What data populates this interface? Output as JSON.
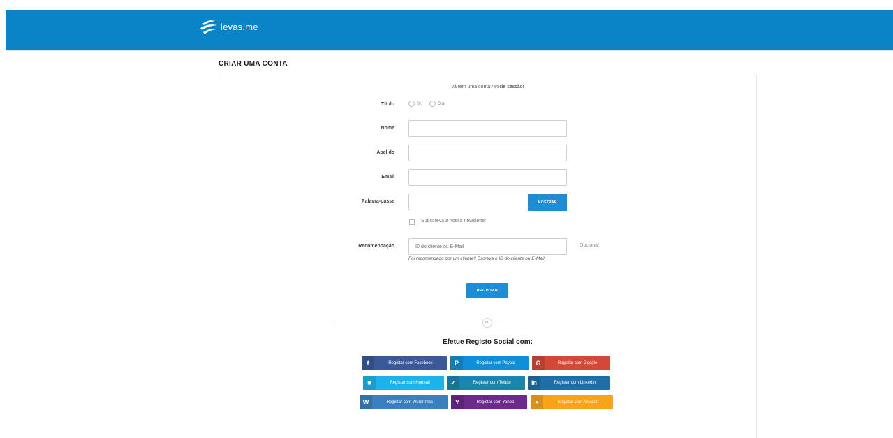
{
  "header": {
    "logo_text": "levas.me"
  },
  "page": {
    "title": "CRIAR UMA CONTA"
  },
  "login_prompt": {
    "text": "Já tem uma conta?",
    "link": "Inicie sessão!"
  },
  "form": {
    "title_label": "Título",
    "title_options": [
      "Sr.",
      "Sra."
    ],
    "name_label": "Nome",
    "surname_label": "Apelido",
    "email_label": "Email",
    "password_label": "Palavra-passe",
    "show_button": "MOSTRAR",
    "newsletter_label": "Subscreva a nossa newsletter",
    "referral_label": "Recomendação",
    "referral_placeholder": "ID do cliente ou E-Mail",
    "optional_label": "Opcional",
    "referral_help": "Foi recomendado por um cliente? Escreva o ID do cliente ou E-Mail.",
    "register_button": "REGISTAR"
  },
  "divider": {
    "or_text": "ou"
  },
  "social": {
    "title": "Efetue Registo Social com:",
    "buttons": [
      {
        "label": "Registar com Facebook",
        "icon": "facebook-icon",
        "glyph": "f",
        "color": "#3b5998"
      },
      {
        "label": "Registar com Paypal",
        "icon": "paypal-icon",
        "glyph": "P",
        "color": "#0f8fd7"
      },
      {
        "label": "Registar com Google",
        "icon": "google-icon",
        "glyph": "G",
        "color": "#d34836"
      },
      {
        "label": "Registar com Hotmail",
        "icon": "hotmail-icon",
        "glyph": "■",
        "color": "#1cb3ea"
      },
      {
        "label": "Registar com Twitter",
        "icon": "twitter-icon",
        "glyph": "✓",
        "color": "#1a86ad"
      },
      {
        "label": "Registar com LinkedIn",
        "icon": "linkedin-icon",
        "glyph": "in",
        "color": "#1e6fa5"
      },
      {
        "label": "Registar com WordPress",
        "icon": "wordpress-icon",
        "glyph": "W",
        "color": "#3a80c1"
      },
      {
        "label": "Registar com Yahoo",
        "icon": "yahoo-icon",
        "glyph": "Y",
        "color": "#6a2b8b"
      },
      {
        "label": "Registar com Amazon",
        "icon": "amazon-icon",
        "glyph": "a",
        "color": "#f9a31a"
      }
    ]
  }
}
